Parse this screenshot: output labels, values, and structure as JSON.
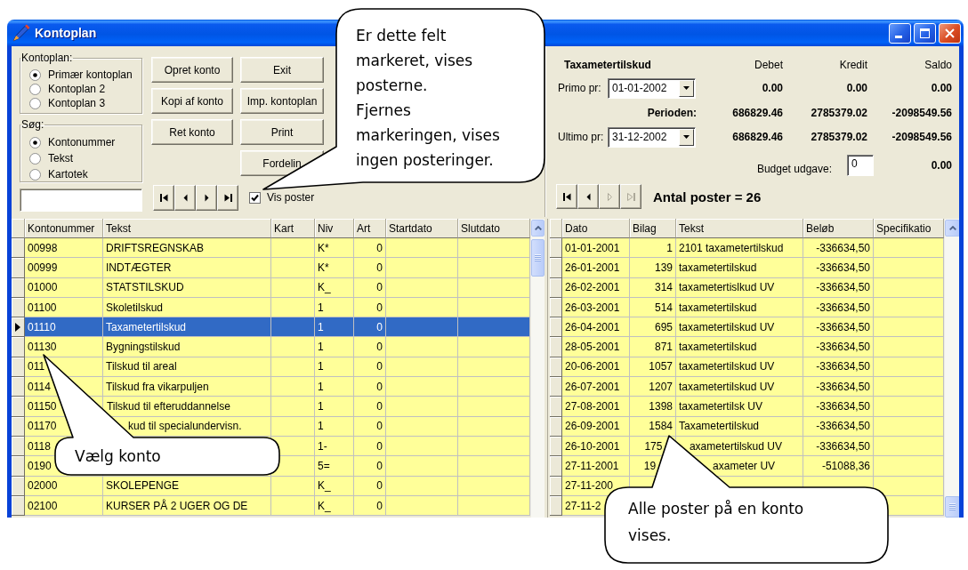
{
  "window": {
    "title": "Kontoplan"
  },
  "kontoplan_group": {
    "label": "Kontoplan:",
    "options": [
      {
        "label": "Primær kontoplan",
        "selected": true
      },
      {
        "label": "Kontoplan 2",
        "selected": false
      },
      {
        "label": "Kontoplan 3",
        "selected": false
      }
    ]
  },
  "search_group": {
    "label": "Søg:",
    "options": [
      {
        "label": "Kontonummer",
        "selected": true
      },
      {
        "label": "Tekst",
        "selected": false
      },
      {
        "label": "Kartotek",
        "selected": false
      }
    ]
  },
  "button_columns": [
    [
      {
        "label": "Opret konto"
      },
      {
        "label": "Kopi af konto"
      },
      {
        "label": "Ret konto"
      }
    ],
    [
      {
        "label": "Exit"
      },
      {
        "label": "Imp. kontoplan"
      },
      {
        "label": "Print"
      },
      {
        "label": "Fordelin"
      }
    ]
  ],
  "account_nav": {
    "buttons": [
      {
        "kind": "first",
        "disabled": false
      },
      {
        "kind": "prev",
        "disabled": false
      },
      {
        "kind": "next",
        "disabled": false
      },
      {
        "kind": "last",
        "disabled": false
      }
    ]
  },
  "show_entries": {
    "label": "Vis poster",
    "checked": true
  },
  "summary": {
    "account_name": "Taxametertilskud",
    "columns": [
      "Debet",
      "Kredit",
      "Saldo"
    ],
    "primo": {
      "label": "Primo pr:",
      "date": "01-01-2002",
      "values": [
        "0.00",
        "0.00",
        "0.00"
      ]
    },
    "period": {
      "label": "Perioden:",
      "values": [
        "686829.46",
        "2785379.02",
        "-2098549.56"
      ]
    },
    "ultimo": {
      "label": "Ultimo pr:",
      "date": "31-12-2002",
      "values": [
        "686829.46",
        "2785379.02",
        "-2098549.56"
      ]
    },
    "budget": {
      "label": "Budget udgave:",
      "value": "0",
      "total": "0.00"
    }
  },
  "entry_nav": {
    "buttons": [
      {
        "kind": "first",
        "disabled": false
      },
      {
        "kind": "prev",
        "disabled": false
      },
      {
        "kind": "next",
        "disabled": true
      },
      {
        "kind": "last",
        "disabled": true
      }
    ],
    "count": "Antal poster = 26"
  },
  "accounts_table": {
    "columns": [
      "Kontonummer",
      "Tekst",
      "Kart",
      "Niv",
      "Art",
      "Startdato",
      "Slutdato"
    ],
    "rows": [
      {
        "kontonummer": "00998",
        "tekst": "DRIFTSREGNSKAB",
        "niv": "K*",
        "art": "0",
        "selected": false
      },
      {
        "kontonummer": "00999",
        "tekst": "INDTÆGTER",
        "niv": "K*",
        "art": "0",
        "selected": false
      },
      {
        "kontonummer": "01000",
        "tekst": "STATSTILSKUD",
        "niv": "K_",
        "art": "0",
        "selected": false
      },
      {
        "kontonummer": "01100",
        "tekst": "Skoletilskud",
        "niv": "1",
        "art": "0",
        "selected": false
      },
      {
        "kontonummer": "01110",
        "tekst": "Taxametertilskud",
        "niv": "1",
        "art": "0",
        "selected": true
      },
      {
        "kontonummer": "01130",
        "tekst": "Bygningstilskud",
        "niv": "1",
        "art": "0",
        "selected": false
      },
      {
        "kontonummer": "011",
        "tekst": "Tilskud til areal",
        "niv": "1",
        "art": "0",
        "selected": false
      },
      {
        "kontonummer": "0114",
        "tekst": "Tilskud fra vikarpuljen",
        "niv": "1",
        "art": "0",
        "selected": false
      },
      {
        "kontonummer": "01150",
        "tekst": "Tilskud til efteruddannelse",
        "niv": "1",
        "art": "0",
        "selected": false
      },
      {
        "kontonummer": "01170",
        "tekst": "kud til specialundervisn.",
        "niv": "1",
        "art": "0",
        "selected": false
      },
      {
        "kontonummer": "0118",
        "niv": "1-",
        "art": "0",
        "selected": false
      },
      {
        "kontonummer": "0190",
        "niv": "5=",
        "art": "0",
        "selected": false
      },
      {
        "kontonummer": "02000",
        "tekst": "SKOLEPENGE",
        "niv": "K_",
        "art": "0",
        "selected": false
      },
      {
        "kontonummer": "02100",
        "tekst": "KURSER PÅ 2 UGER OG DE",
        "niv": "K_",
        "art": "0",
        "selected": false
      }
    ]
  },
  "entries_table": {
    "columns": [
      "Dato",
      "Bilag",
      "Tekst",
      "Beløb",
      "Specifikatio"
    ],
    "rows": [
      {
        "dato": "01-01-2001",
        "bilag": "1",
        "tekst": "2101 taxametertilskud",
        "belob": "-336634,50",
        "selected": false
      },
      {
        "dato": "26-01-2001",
        "bilag": "139",
        "tekst": "taxametertilskud",
        "belob": "-336634,50",
        "selected": false
      },
      {
        "dato": "26-02-2001",
        "bilag": "314",
        "tekst": "taxametertislkud UV",
        "belob": "-336634,50",
        "selected": false
      },
      {
        "dato": "26-03-2001",
        "bilag": "514",
        "tekst": "taxametertilskud",
        "belob": "-336634,50",
        "selected": false
      },
      {
        "dato": "26-04-2001",
        "bilag": "695",
        "tekst": "taxametertilskud UV",
        "belob": "-336634,50",
        "selected": false
      },
      {
        "dato": "28-05-2001",
        "bilag": "871",
        "tekst": "taxametertilskud",
        "belob": "-336634,50",
        "selected": false
      },
      {
        "dato": "20-06-2001",
        "bilag": "1057",
        "tekst": "taxametertilskud UV",
        "belob": "-336634,50",
        "selected": false
      },
      {
        "dato": "26-07-2001",
        "bilag": "1207",
        "tekst": "taxametertilskud UV",
        "belob": "-336634,50",
        "selected": false
      },
      {
        "dato": "27-08-2001",
        "bilag": "1398",
        "tekst": "taxametertilsk UV",
        "belob": "-336634,50",
        "selected": false
      },
      {
        "dato": "26-09-2001",
        "bilag": "1584",
        "tekst": "Taxametertilskud",
        "belob": "-336634,50",
        "selected": false
      },
      {
        "dato": "26-10-2001",
        "bilag": "175",
        "tekst": "axametertilskud UV",
        "belob": "-336634,50",
        "selected": false
      },
      {
        "dato": "27-11-2001",
        "bilag": "19",
        "tekst": "axameter UV",
        "belob": "-51088,36",
        "selected": false
      },
      {
        "dato": "27-11-200",
        "selected": false
      },
      {
        "dato": "27-11-2",
        "selected": false
      }
    ]
  },
  "callouts": [
    {
      "paragraphs": [
        "Er dette felt markeret, vises posterne.",
        "Fjernes markeringen, vises ingen posteringer."
      ]
    },
    {
      "paragraphs": [
        "Vælg konto"
      ]
    },
    {
      "paragraphs": [
        "Alle poster på en konto vises."
      ]
    }
  ]
}
